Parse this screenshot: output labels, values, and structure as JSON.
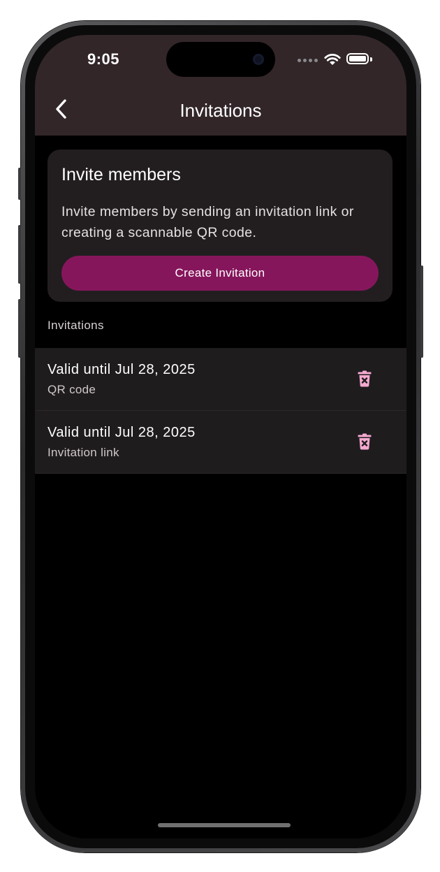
{
  "status_bar": {
    "time": "9:05",
    "battery_level": 1.0
  },
  "app_bar": {
    "title": "Invitations",
    "back_icon": "chevron-left-icon"
  },
  "invite_card": {
    "title": "Invite members",
    "description": "Invite members by sending an invitation link or creating a scannable QR code.",
    "button_label": "Create Invitation"
  },
  "section": {
    "label": "Invitations"
  },
  "invitations": [
    {
      "title": "Valid until Jul 28, 2025",
      "type": "QR code",
      "action_icon": "delete-icon"
    },
    {
      "title": "Valid until Jul 28, 2025",
      "type": "Invitation link",
      "action_icon": "delete-icon"
    }
  ],
  "colors": {
    "app_bar_bg": "#322629",
    "card_bg": "#221e20",
    "primary": "#86165c",
    "delete_icon": "#f4a9cf",
    "screen_bg": "#000000"
  }
}
